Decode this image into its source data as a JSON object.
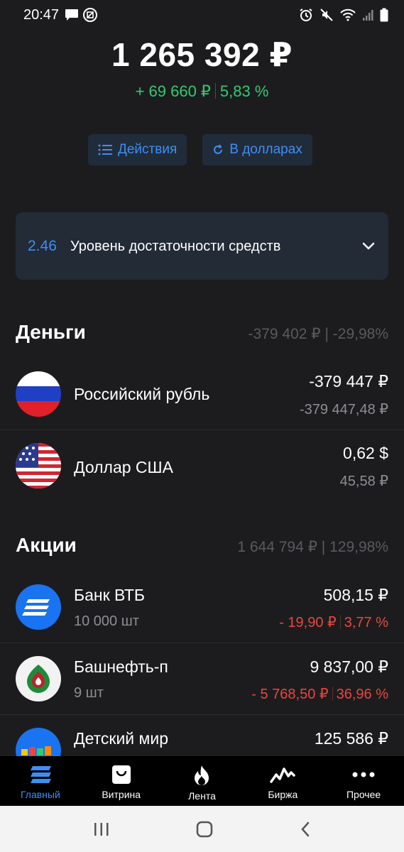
{
  "status": {
    "time": "20:47"
  },
  "portfolio": {
    "total": "1 265 392 ₽",
    "gain_abs": "+ 69 660 ₽",
    "gain_pct": "5,83 %"
  },
  "actions": {
    "actions_label": "Действия",
    "dollars_label": "В долларах"
  },
  "sufficiency": {
    "value": "2.46",
    "label": "Уровень достаточности средств"
  },
  "money": {
    "title": "Деньги",
    "summary": "-379 402 ₽ | -29,98%",
    "items": [
      {
        "name": "Российский рубль",
        "value": "-379 447 ₽",
        "value2": "-379 447,48 ₽",
        "flag": "russia-flag-icon"
      },
      {
        "name": "Доллар США",
        "value": "0,62 $",
        "value2": "45,58 ₽",
        "flag": "usa-flag-icon"
      }
    ]
  },
  "stocks": {
    "title": "Акции",
    "summary": "1 644 794 ₽ | 129,98%",
    "items": [
      {
        "name": "Банк ВТБ",
        "qty": "10 000 шт",
        "price": "508,15 ₽",
        "change_abs": "- 19,90 ₽",
        "change_pct": "3,77 %",
        "logo": "vtb-logo-icon"
      },
      {
        "name": "Башнефть-п",
        "qty": "9 шт",
        "price": "9 837,00 ₽",
        "change_abs": "- 5 768,50 ₽",
        "change_pct": "36,96 %",
        "logo": "bashneft-logo-icon"
      },
      {
        "name": "Детский мир",
        "price": "125 586 ₽",
        "logo": "detmir-logo-icon"
      }
    ]
  },
  "colors": {
    "accent": "#3f8ef5",
    "positive": "#2ecc71",
    "negative": "#e8473f",
    "background": "#1c1c1e"
  },
  "nav": {
    "items": [
      {
        "label": "Главный",
        "icon": "home-stack-icon",
        "active": true
      },
      {
        "label": "Витрина",
        "icon": "shopping-bag-icon",
        "active": false
      },
      {
        "label": "Лента",
        "icon": "flame-icon",
        "active": false
      },
      {
        "label": "Биржа",
        "icon": "chart-pulse-icon",
        "active": false
      },
      {
        "label": "Прочее",
        "icon": "more-dots-icon",
        "active": false
      }
    ]
  }
}
